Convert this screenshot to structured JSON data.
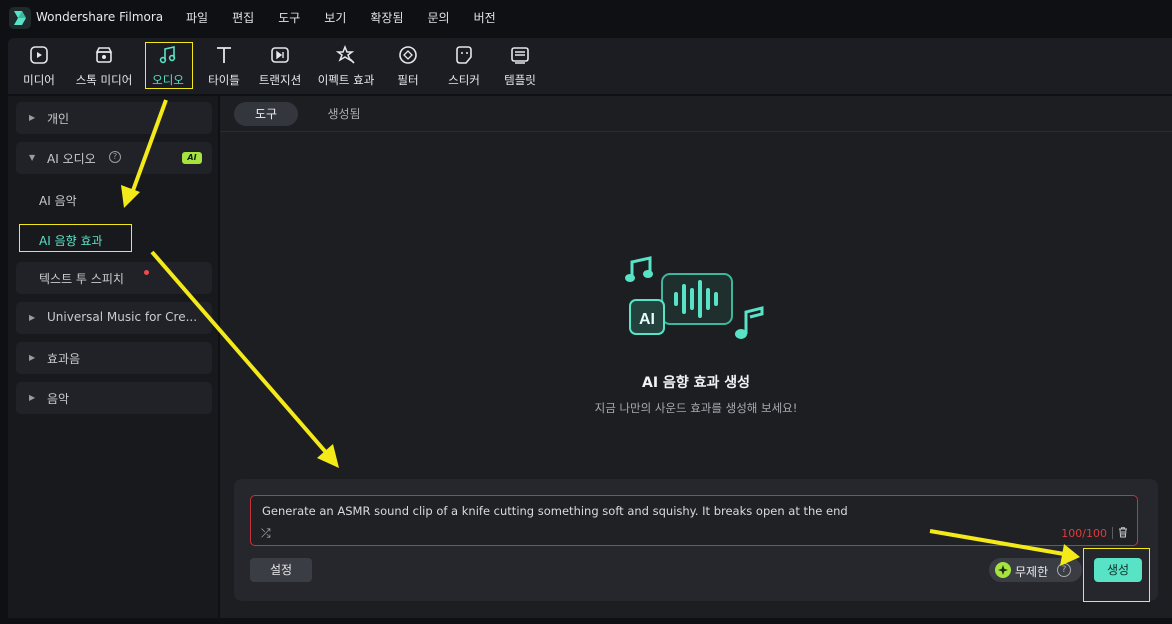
{
  "app": {
    "name": "Wondershare Filmora"
  },
  "menu": [
    "파일",
    "편집",
    "도구",
    "보기",
    "확장됨",
    "문의",
    "버전"
  ],
  "toolbar": {
    "items": [
      {
        "label": "미디어",
        "icon": "media-icon"
      },
      {
        "label": "스톡 미디어",
        "icon": "stock-media-icon"
      },
      {
        "label": "오디오",
        "icon": "audio-icon",
        "active": true
      },
      {
        "label": "타이틀",
        "icon": "title-icon"
      },
      {
        "label": "트랜지션",
        "icon": "transition-icon"
      },
      {
        "label": "이펙트 효과",
        "icon": "effects-icon"
      },
      {
        "label": "필터",
        "icon": "filter-icon"
      },
      {
        "label": "스티커",
        "icon": "sticker-icon"
      },
      {
        "label": "템플릿",
        "icon": "template-icon"
      }
    ]
  },
  "sidebar": {
    "personal": "개인",
    "ai_audio": "AI 오디오",
    "ai_badge": "AI",
    "ai_music": "AI 음악",
    "ai_sfx": "AI 음향 효과",
    "tts": "텍스트 투 스피치",
    "universal": "Universal Music for Cre...",
    "sfx": "효과음",
    "music": "음악"
  },
  "tabs": {
    "tools": "도구",
    "generated": "생성됨"
  },
  "hero": {
    "title": "AI 음향 효과 생성",
    "subtitle": "지금 나만의 사운드 효과를 생성해 보세요!",
    "badge": "AI"
  },
  "prompt": {
    "text": "Generate an ASMR sound clip of a knife cutting something soft and squishy. It breaks open at the end",
    "counter": "100/100"
  },
  "buttons": {
    "settings": "설정",
    "unlimited": "무제한",
    "generate": "생성"
  },
  "colors": {
    "accent": "#59e3c6",
    "annotation": "#f4ea1a",
    "error": "#e13b3b",
    "ai_badge": "#a6e33e"
  }
}
